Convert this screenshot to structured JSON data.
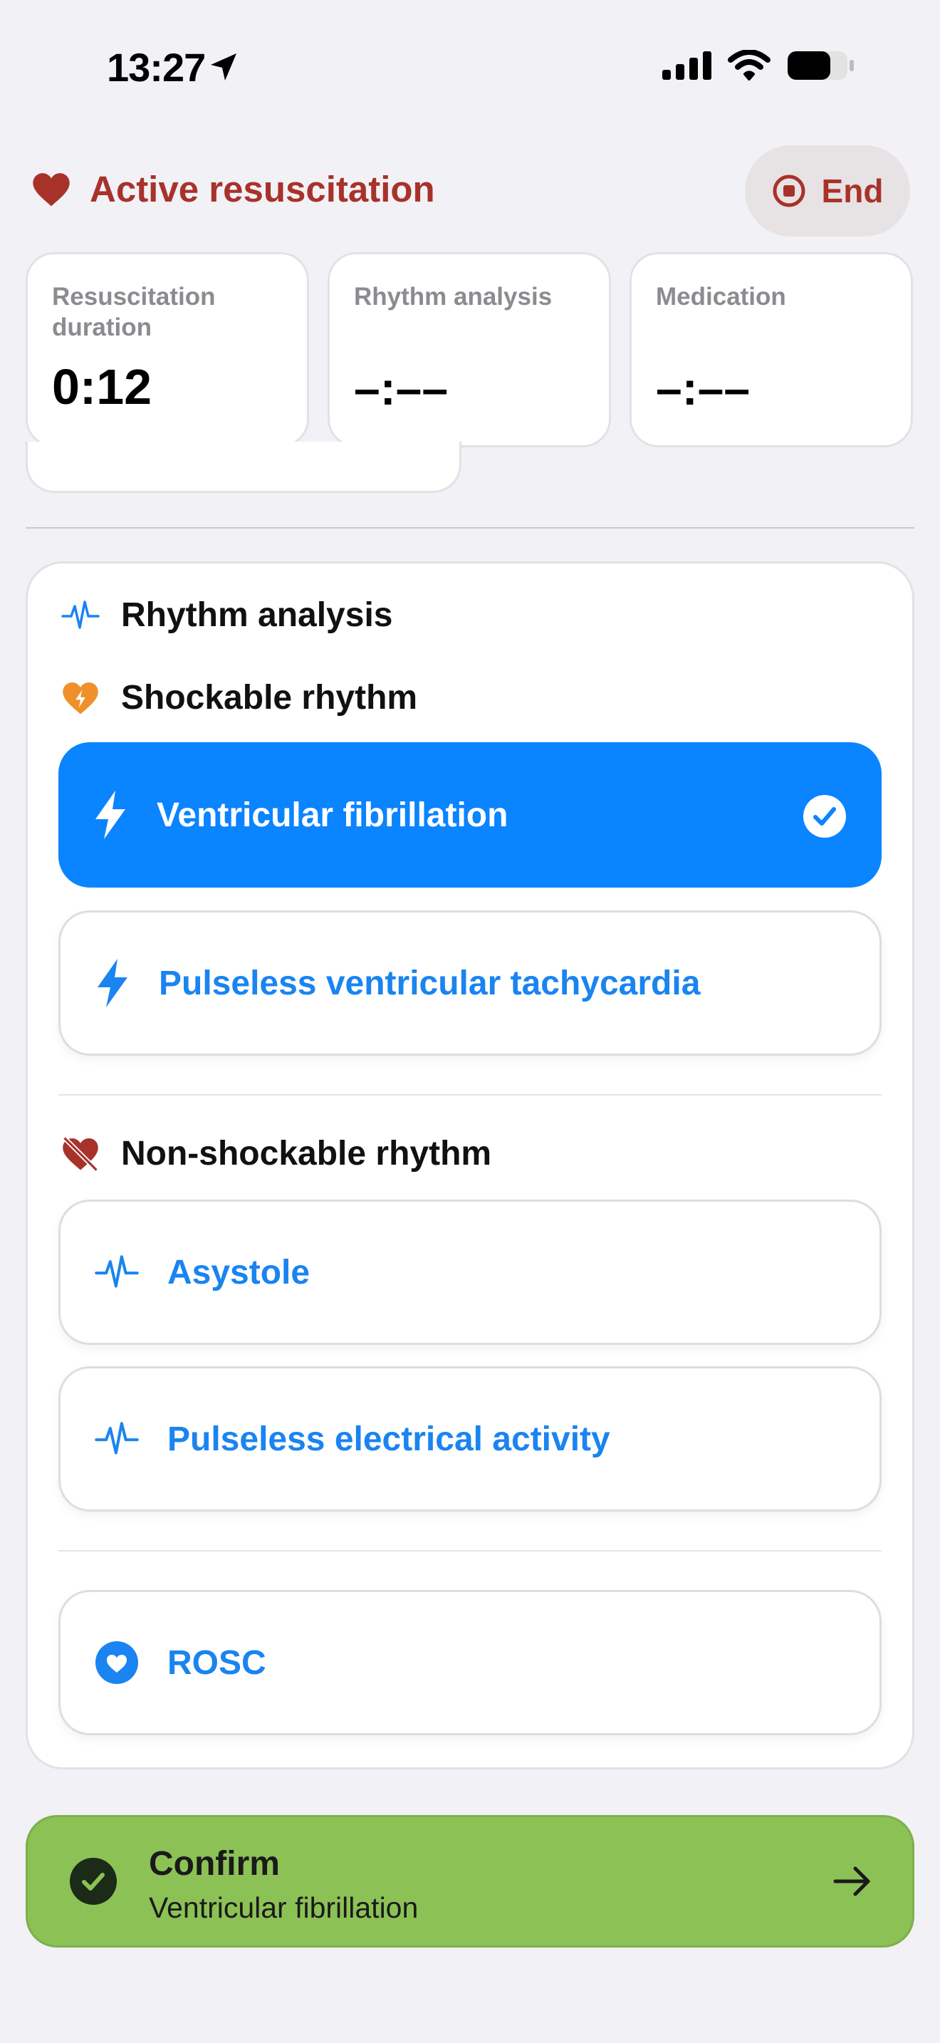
{
  "status_bar": {
    "time": "13:27"
  },
  "header": {
    "title": "Active resuscitation",
    "end_label": "End"
  },
  "stats": [
    {
      "label": "Resuscitation duration",
      "value": "0:12"
    },
    {
      "label": "Rhythm analysis",
      "value": "–:––"
    },
    {
      "label": "Medication",
      "value": "–:––"
    }
  ],
  "panel": {
    "title": "Rhythm analysis",
    "shockable_heading": "Shockable rhythm",
    "shockable_options": [
      "Ventricular fibrillation",
      "Pulseless ventricular tachycardia"
    ],
    "non_shockable_heading": "Non-shockable rhythm",
    "non_shockable_options": [
      "Asystole",
      "Pulseless electrical activity"
    ],
    "rosc_label": "ROSC",
    "selected": "Ventricular fibrillation"
  },
  "confirm": {
    "label": "Confirm",
    "selection": "Ventricular fibrillation"
  },
  "colors": {
    "accent": "#0a84ff",
    "danger": "#a8322a",
    "confirm": "#8cc156",
    "warning": "#f0902a"
  }
}
